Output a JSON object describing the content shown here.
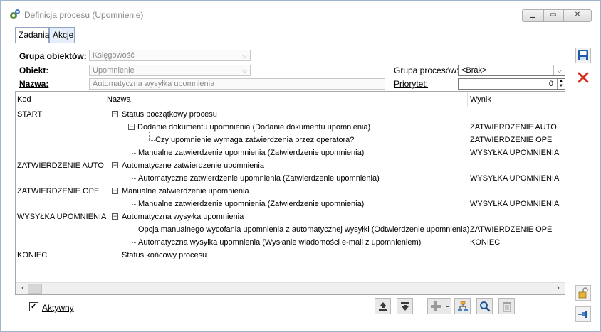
{
  "window": {
    "title": "Definicja procesu (Upomnienie)"
  },
  "tabs": [
    {
      "label": "Zadania"
    },
    {
      "label": "Akcje"
    }
  ],
  "form": {
    "grupa_obiektow": {
      "label": "Grupa obiektów:",
      "value": "Księgowość"
    },
    "obiekt": {
      "label": "Obiekt:",
      "value": "Upomnienie"
    },
    "nazwa": {
      "label": "Nazwa:",
      "value": "Automatyczna wysyłka upomnienia"
    },
    "grupa_procesow": {
      "label": "Grupa procesów:",
      "value": "<Brak>"
    },
    "priorytet": {
      "label": "Priorytet:",
      "value": "0"
    }
  },
  "grid": {
    "headers": {
      "kod": "Kod",
      "nazwa": "Nazwa",
      "wynik": "Wynik"
    },
    "rows": [
      {
        "kod": "START",
        "nazwa": "Status początkowy procesu",
        "wynik": ""
      },
      {
        "kod": "",
        "nazwa": "Dodanie dokumentu upomnienia (Dodanie dokumentu upomnienia)",
        "wynik": "ZATWIERDZENIE AUTO"
      },
      {
        "kod": "",
        "nazwa": "Czy upomnienie wymaga zatwierdzenia przez operatora?",
        "wynik": "ZATWIERDZENIE OPE"
      },
      {
        "kod": "",
        "nazwa": "Manualne zatwierdzenie upomnienia (Zatwierdzenie upomnienia)",
        "wynik": "WYSYŁKA UPOMNIENIA"
      },
      {
        "kod": "ZATWIERDZENIE AUTO",
        "nazwa": "Automatyczne zatwierdzenie upomnienia",
        "wynik": ""
      },
      {
        "kod": "",
        "nazwa": "Automatyczne zatwierdzenie upomnienia (Zatwierdzenie upomnienia)",
        "wynik": "WYSYŁKA UPOMNIENIA"
      },
      {
        "kod": "ZATWIERDZENIE OPE",
        "nazwa": "Manualne zatwierdzenie upomnienia",
        "wynik": ""
      },
      {
        "kod": "",
        "nazwa": "Manualne zatwierdzenie upomnienia (Zatwierdzenie upomnienia)",
        "wynik": "WYSYŁKA UPOMNIENIA"
      },
      {
        "kod": "WYSYŁKA UPOMNIENIA",
        "nazwa": "Automatyczna wysyłka upomnienia",
        "wynik": ""
      },
      {
        "kod": "",
        "nazwa": "Opcja manualnego wycofania upomnienia z automatycznej wysyłki (Odtwierdzenie upomnienia)",
        "wynik": "ZATWIERDZENIE OPE"
      },
      {
        "kod": "",
        "nazwa": "Automatyczna wysyłka upomnienia (Wysłanie wiadomości e-mail z upomnieniem)",
        "wynik": "KONIEC"
      },
      {
        "kod": "KONIEC",
        "nazwa": "Status końcowy procesu",
        "wynik": ""
      }
    ]
  },
  "footer": {
    "aktywny_label": "Aktywny",
    "aktywny_checked": true
  },
  "icons": {
    "save": "save-icon",
    "delete": "delete-icon",
    "move_up": "move-up-icon",
    "move_down": "move-down-icon",
    "add": "add-icon",
    "hierarchy": "hierarchy-icon",
    "preview": "magnifier-icon",
    "trash": "trash-icon",
    "lock": "padlock-icon",
    "pin": "pin-icon"
  },
  "colors": {
    "accent": "#1e5aa8",
    "delete_red": "#d6281c"
  }
}
